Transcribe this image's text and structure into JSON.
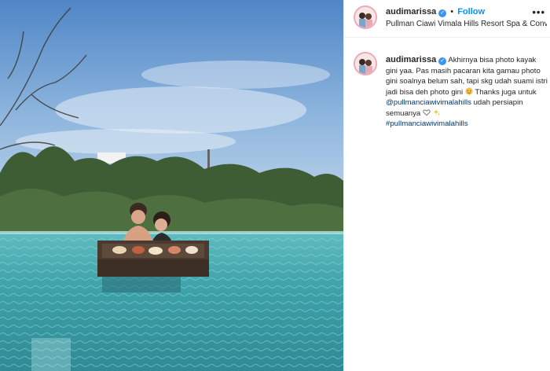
{
  "post": {
    "username": "audimarissa",
    "follow_label": "Follow",
    "location": "Pullman Ciawi Vimala Hills Resort Spa & Conv...",
    "more_label": "•••",
    "separator": "•"
  },
  "caption": {
    "username": "audimarissa",
    "text_1": "Akhirnya bisa photo kayak gini yaa. Pas masih pacaran kita gamau photo gini soalnya belum sah, tapi skg udah suami istri jadi bisa deh photo gini",
    "text_2": "Thanks juga untuk",
    "mention": "@pullmanciawivimalahills",
    "text_3": "udah persiapin semuanya",
    "hashtag": "#pullmanciawivimalahills"
  },
  "colors": {
    "link": "#0095f6",
    "mention": "#00376b",
    "verified": "#3897f0"
  },
  "icons": [
    "verified-badge-icon",
    "more-options-icon",
    "heart-emoji-icon",
    "sparkles-emoji-icon",
    "blush-emoji-icon"
  ]
}
